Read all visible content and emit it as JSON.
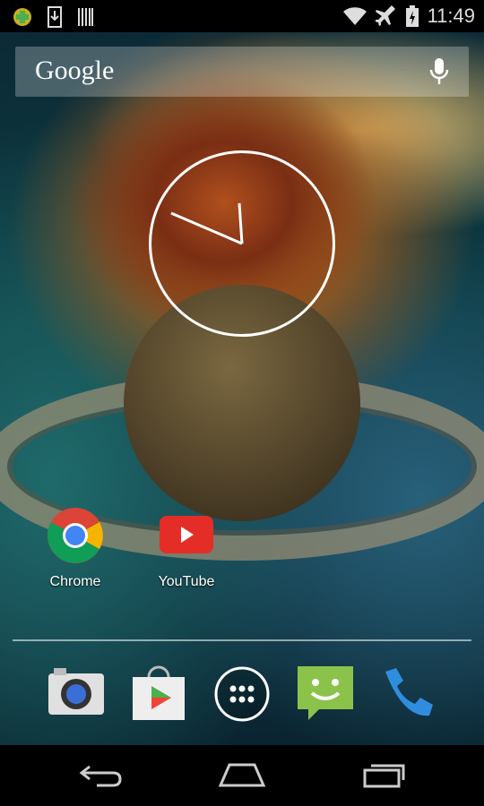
{
  "status_bar": {
    "time": "11:49",
    "left_icons": [
      "security-app-icon",
      "download-icon",
      "barcode-icon"
    ],
    "right_icons": [
      "wifi-icon",
      "airplane-mode-icon",
      "battery-charging-icon"
    ]
  },
  "search": {
    "logo": "Google",
    "icon": "mic-icon"
  },
  "clock_widget": {
    "hour_hand": "11",
    "minute_hand": "49"
  },
  "apps": [
    {
      "label": "Chrome"
    },
    {
      "label": "YouTube"
    }
  ],
  "dock": [
    "camera",
    "play-store",
    "app-drawer",
    "messaging",
    "phone"
  ],
  "nav": [
    "back",
    "home",
    "recents"
  ]
}
